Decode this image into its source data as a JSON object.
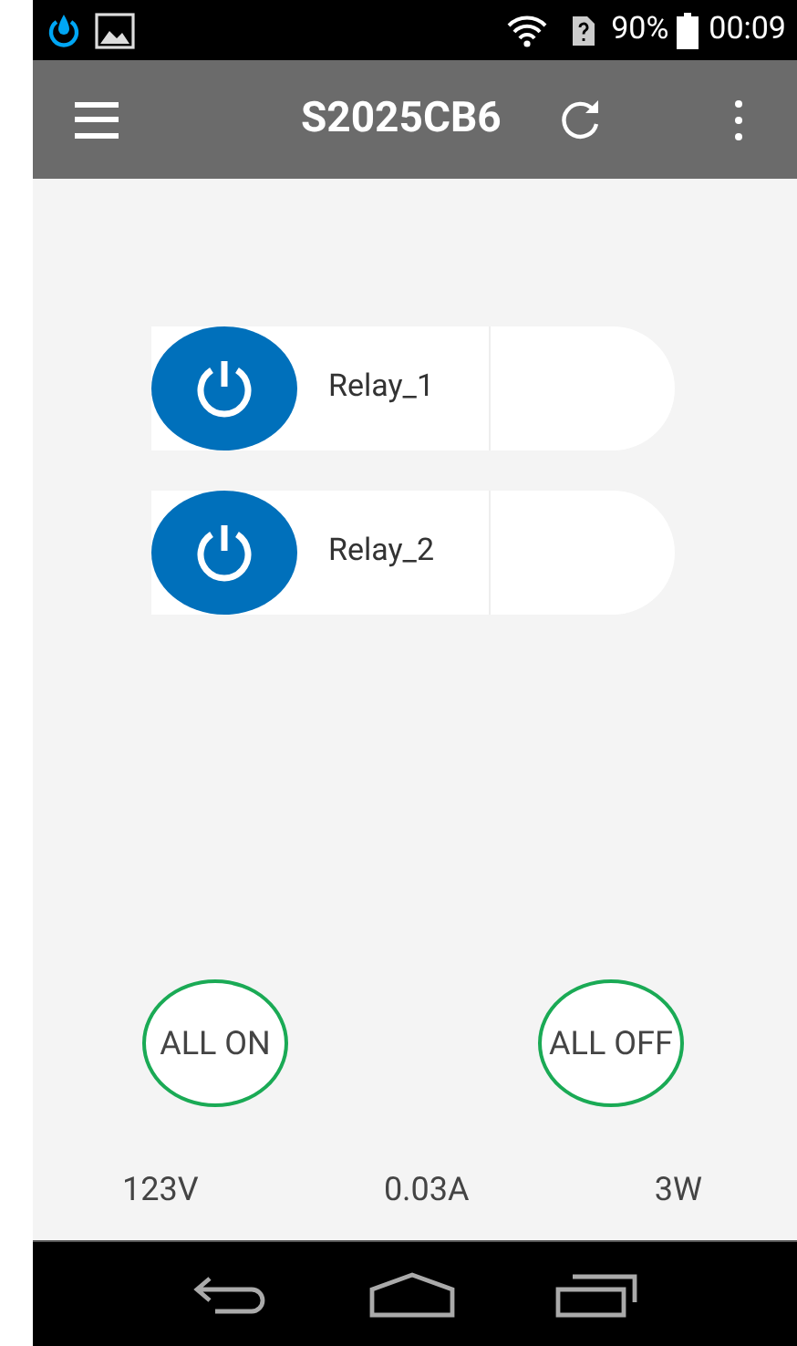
{
  "status_bar": {
    "battery": "90%",
    "time": "00:09"
  },
  "app_bar": {
    "title": "S2025CB6"
  },
  "relays": [
    {
      "label": "Relay_1",
      "on": true
    },
    {
      "label": "Relay_2",
      "on": true
    }
  ],
  "buttons": [
    "ALL ON",
    "ALL OFF"
  ],
  "readings": [
    "123V",
    "0.03A",
    "3W"
  ]
}
